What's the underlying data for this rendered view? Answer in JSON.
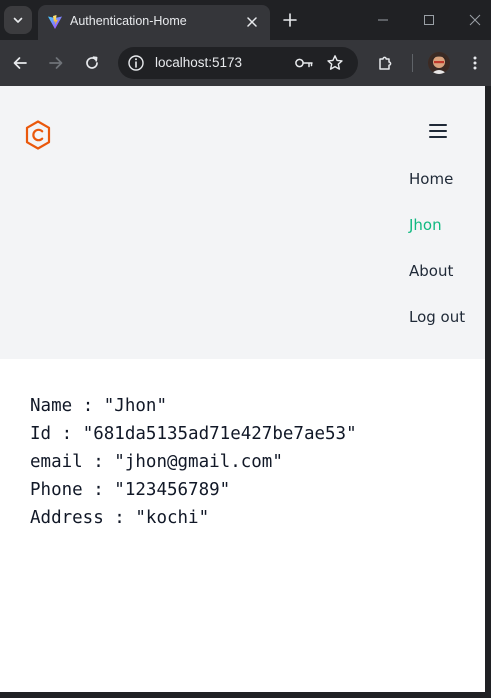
{
  "browser": {
    "tab_title": "Authentication-Home",
    "url": "localhost:5173"
  },
  "navbar": {
    "items": [
      {
        "label": "Home",
        "active": false
      },
      {
        "label": "Jhon",
        "active": true
      },
      {
        "label": "About",
        "active": false
      },
      {
        "label": "Log out",
        "active": false
      }
    ],
    "active_color": "#10b981",
    "logo_color": "#ea580c"
  },
  "user": {
    "rows": [
      {
        "label": "Name",
        "value": "\"Jhon\""
      },
      {
        "label": "Id",
        "value": "\"681da5135ad71e427be7ae53\""
      },
      {
        "label": "email",
        "value": "\"jhon@gmail.com\""
      },
      {
        "label": "Phone",
        "value": "\"123456789\""
      },
      {
        "label": "Address",
        "value": "\"kochi\""
      }
    ]
  },
  "icons": {
    "tab_search": "chevron-down-icon",
    "favicon": "vite-logo-icon",
    "close": "close-icon",
    "new_tab": "plus-icon",
    "minimize": "minimize-icon",
    "maximize": "maximize-icon",
    "window_close": "close-icon",
    "back": "arrow-left-icon",
    "forward": "arrow-right-icon",
    "reload": "reload-icon",
    "site_info": "info-icon",
    "password": "key-icon",
    "bookmark": "star-icon",
    "extensions": "puzzle-icon",
    "menu": "kebab-menu-icon",
    "app_logo": "hexagon-c-logo-icon",
    "nav_menu": "hamburger-menu-icon"
  }
}
